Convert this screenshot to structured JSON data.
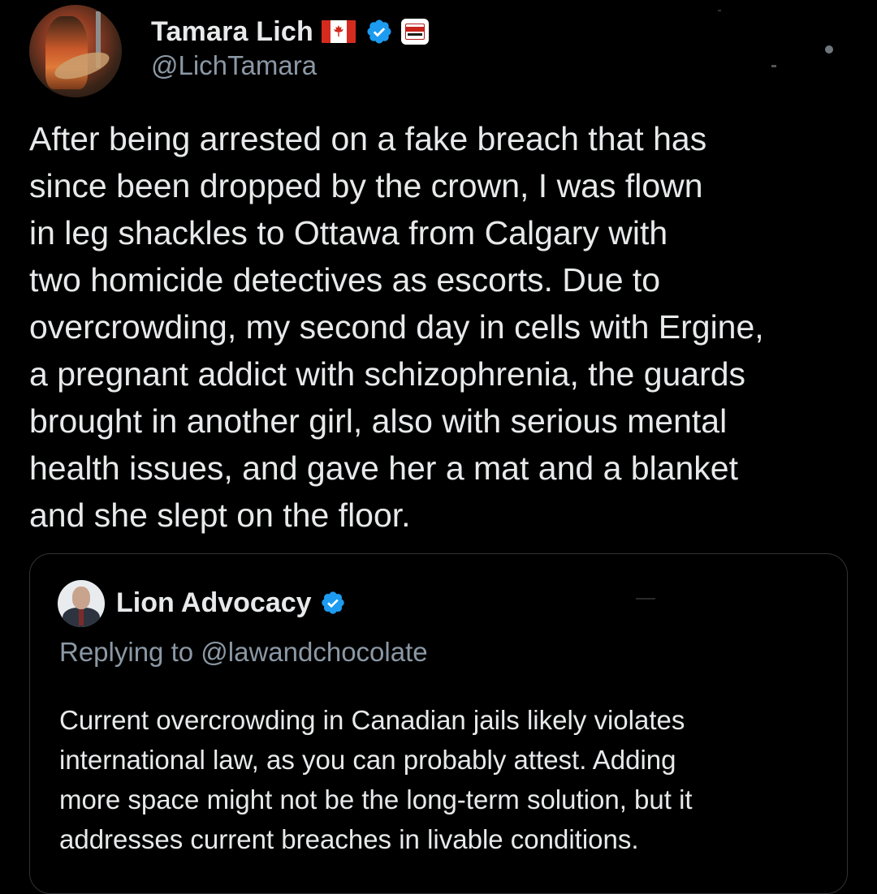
{
  "tweet": {
    "author": {
      "display_name": "Tamara Lich",
      "handle": "@LichTamara",
      "badges": [
        "canada-flag-emoji",
        "verified-badge-icon",
        "affiliate-badge-icon"
      ]
    },
    "text": "After being arrested on a fake breach that has\nsince been dropped by the crown, I was flown\nin leg shackles to Ottawa from Calgary with\ntwo homicide detectives as escorts.   Due to\novercrowding, my second day in cells with Ergine,\na pregnant addict with schizophrenia, the guards\nbrought in another girl, also with serious mental\nhealth issues, and gave her a mat and a blanket\nand she slept on the floor."
  },
  "quoted_tweet": {
    "author": {
      "display_name": "Lion Advocacy",
      "badges": [
        "verified-badge-icon"
      ]
    },
    "replying_to": "Replying to @lawandchocolate",
    "text": "Current overcrowding in Canadian jails likely violates\ninternational law, as you can probably attest. Adding\nmore space might not be the long-term solution, but it\naddresses current breaches in livable conditions."
  },
  "colors": {
    "background": "#000000",
    "primary_text": "#e7e9ea",
    "secondary_text": "#8b98a5",
    "verified_blue": "#1d9bf0",
    "border": "#2f3336"
  }
}
